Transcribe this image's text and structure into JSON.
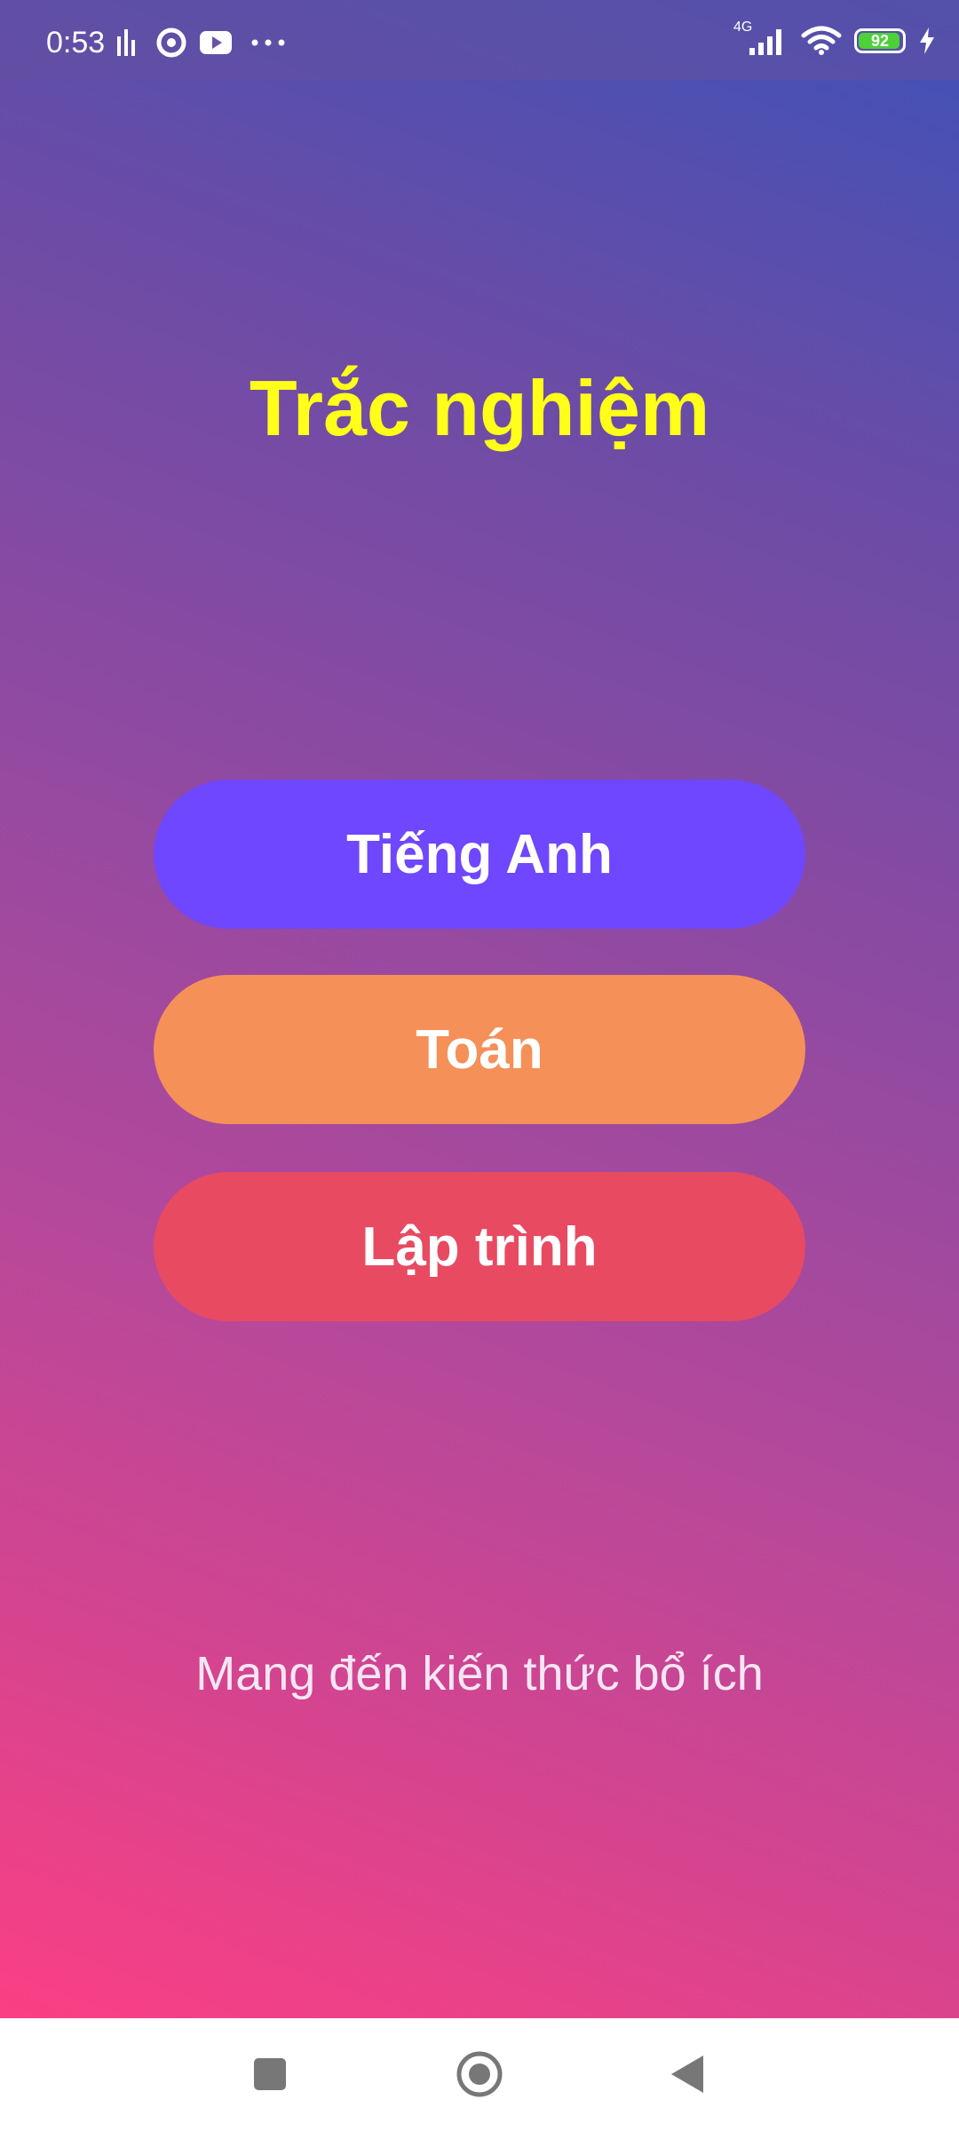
{
  "status_bar": {
    "time": "0:53",
    "network": "4G",
    "battery_level": "92",
    "left_icons": [
      "activity-bars-icon",
      "chrome-icon",
      "youtube-icon",
      "more-dots-icon"
    ],
    "right_icons": [
      "signal-icon",
      "wifi-icon",
      "battery-icon",
      "charging-icon"
    ],
    "battery_color": "#4cd137"
  },
  "main": {
    "title": "Trắc nghiệm",
    "title_color": "#ffff1a",
    "buttons": [
      {
        "label": "Tiếng Anh",
        "color": "#6f47ff"
      },
      {
        "label": "Toán",
        "color": "#f59058"
      },
      {
        "label": "Lập trình",
        "color": "#e84a62"
      }
    ],
    "tagline": "Mang đến kiến thức bổ ích"
  },
  "nav_bar": {
    "icons": [
      "recent-apps-icon",
      "home-icon",
      "back-icon"
    ]
  },
  "colors": {
    "gradient_top": "#3f52b8",
    "gradient_bottom": "#fb3f84"
  }
}
